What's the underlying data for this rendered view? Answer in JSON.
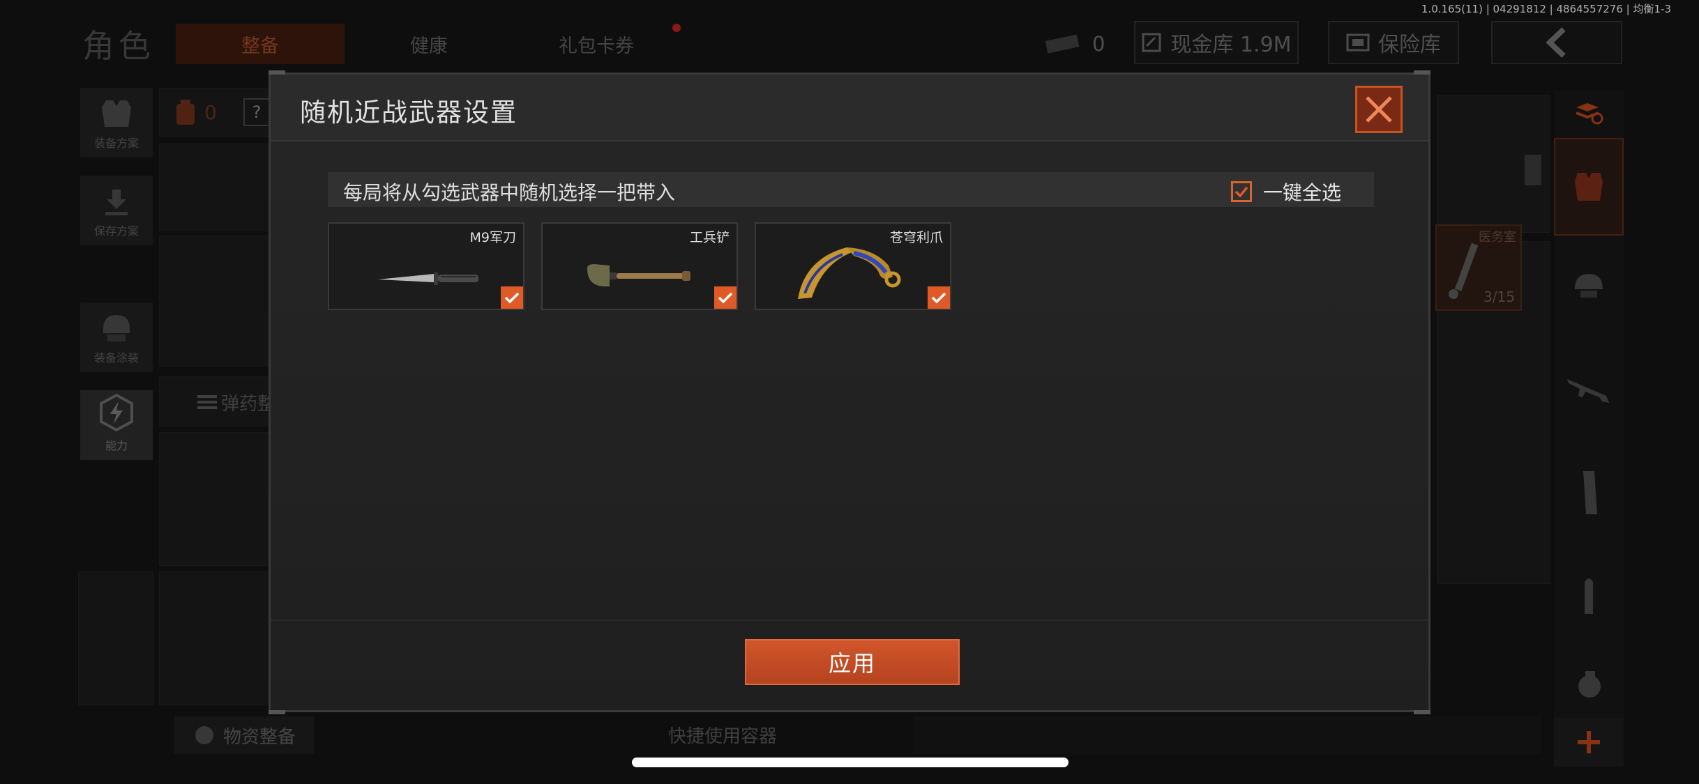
{
  "status": {
    "version_info": "1.0.165(11) | 04291812 | 4864557276 | 均衡1-3"
  },
  "header": {
    "title": "角色",
    "tabs": [
      {
        "label": "整备",
        "active": true
      },
      {
        "label": "健康",
        "active": false
      },
      {
        "label": "礼包卡券",
        "active": false,
        "has_notification": true
      }
    ],
    "ticket_count": "0",
    "cash_vault_label": "现金库 1.9M",
    "safe_label": "保险库",
    "back_icon": "chevron-left-icon"
  },
  "sidebar": {
    "items": [
      {
        "label": "装备方案",
        "icon": "vest-icon"
      },
      {
        "label": "保存方案",
        "icon": "download-icon"
      },
      {
        "label": "装备涂装",
        "icon": "helmet-icon"
      },
      {
        "label": "能力",
        "icon": "lightning-hex-icon",
        "active": true
      }
    ]
  },
  "background": {
    "bag_count": "0",
    "help_icon": "?",
    "ammo_label": "弹药整",
    "medical_label": "医务室",
    "medical_count": "3/15",
    "supplies_label": "物资整备",
    "quick_container_label": "快捷使用容器"
  },
  "modal": {
    "title": "随机近战武器设置",
    "hint": "每局将从勾选武器中随机选择一把带入",
    "select_all_label": "一键全选",
    "select_all_checked": true,
    "weapons": [
      {
        "name": "M9军刀",
        "checked": true,
        "icon": "combat-knife-icon"
      },
      {
        "name": "工兵铲",
        "checked": true,
        "icon": "shovel-icon"
      },
      {
        "name": "苍穹利爪",
        "checked": true,
        "icon": "karambit-icon"
      }
    ],
    "apply_label": "应用"
  },
  "colors": {
    "accent": "#e05a27",
    "close_bg": "#7a2a14",
    "modal_bg": "#232323"
  }
}
